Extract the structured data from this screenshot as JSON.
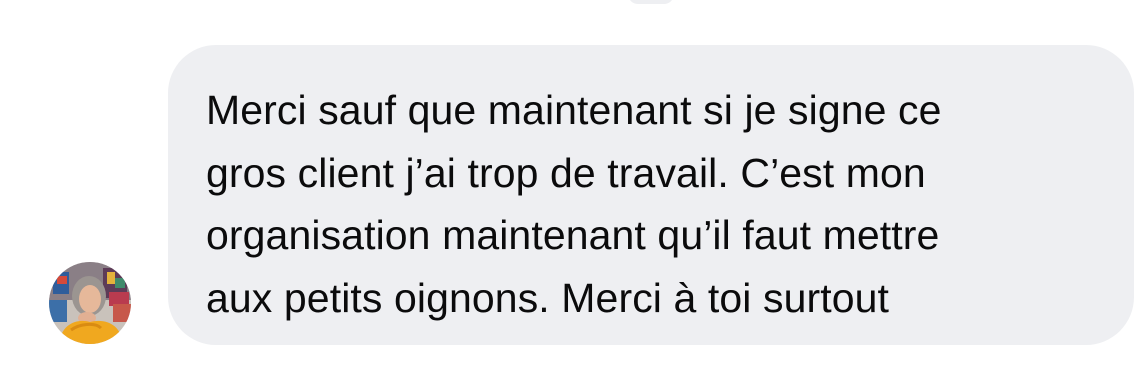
{
  "message": {
    "sender_avatar_icon": "user-avatar-photo",
    "lines": [
      "Merci sauf que maintenant si je signe ce",
      "gros client j’ai trop de travail. C’est mon",
      "organisation maintenant qu’il faut mettre",
      "aux petits oignons. Merci à toi surtout"
    ]
  },
  "colors": {
    "page_background": "#ffffff",
    "bubble_background": "#eeeff2",
    "text": "#0b0b0c"
  }
}
